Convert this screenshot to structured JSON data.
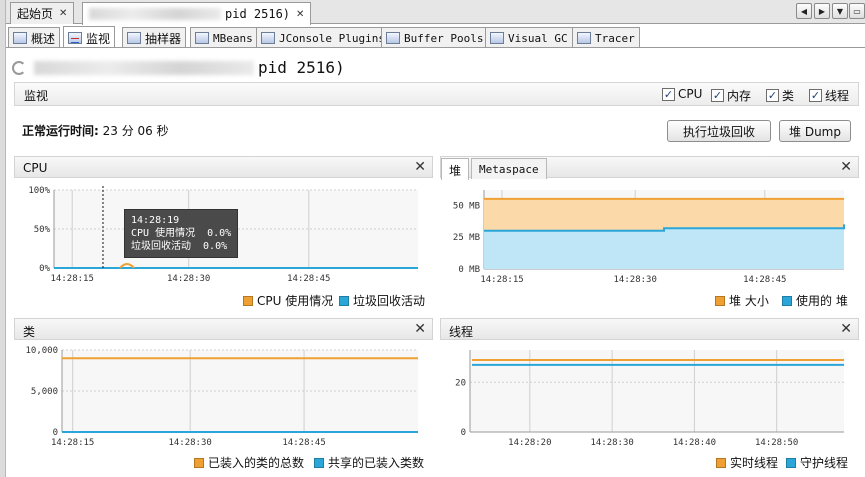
{
  "document_tabs": [
    {
      "label": "起始页",
      "active": false
    },
    {
      "label_suffix": "pid 2516)",
      "active": true
    }
  ],
  "nav": {
    "left": "◀",
    "right": "▶",
    "menu": "▼",
    "restore": "▭"
  },
  "sub_tabs": [
    {
      "label": "概述",
      "icon": "info-icon"
    },
    {
      "label": "监视",
      "icon": "chart-icon",
      "active": true
    },
    {
      "label": "抽样器",
      "icon": "sampler-icon"
    },
    {
      "label": "MBeans",
      "icon": "beans-icon"
    },
    {
      "label": "JConsole Plugins",
      "icon": "plugin-icon"
    },
    {
      "label": "Buffer Pools",
      "icon": "buffer-icon"
    },
    {
      "label": "Visual GC",
      "icon": "gc-icon"
    },
    {
      "label": "Tracer",
      "icon": "tracer-icon"
    }
  ],
  "app_title_suffix": "pid 2516)",
  "monitor": {
    "title": "监视",
    "checkboxes": [
      {
        "label": "CPU",
        "checked": true
      },
      {
        "label": "内存",
        "checked": true
      },
      {
        "label": "类",
        "checked": true
      },
      {
        "label": "线程",
        "checked": true
      }
    ]
  },
  "uptime": {
    "label": "正常运行时间:",
    "value": "23 分 06 秒"
  },
  "buttons": {
    "gc": "执行垃圾回收",
    "heap_dump": "堆 Dump"
  },
  "colors": {
    "orange": "#f0a032",
    "blue": "#2aa7d8",
    "orange_fill": "#fbd9a8",
    "blue_fill": "#bfe6f6"
  },
  "panels": {
    "cpu": {
      "title": "CPU",
      "y_ticks": [
        "100%",
        "50%",
        "0%"
      ],
      "x_ticks": [
        "14:28:15",
        "14:28:30",
        "14:28:45"
      ],
      "legend": [
        "CPU 使用情况",
        "垃圾回收活动"
      ],
      "tooltip": {
        "time": "14:28:19",
        "cpu": "CPU 使用情况  0.0%",
        "gc": "垃圾回收活动  0.0%"
      }
    },
    "heap": {
      "tabs": [
        "堆",
        "Metaspace"
      ],
      "y_ticks": [
        "50 MB",
        "25 MB",
        "0 MB"
      ],
      "x_ticks": [
        "14:28:15",
        "14:28:30",
        "14:28:45"
      ],
      "legend": [
        "堆 大小",
        "使用的 堆"
      ]
    },
    "classes": {
      "title": "类",
      "y_ticks": [
        "10,000",
        "5,000",
        "0"
      ],
      "x_ticks": [
        "14:28:15",
        "14:28:30",
        "14:28:45"
      ],
      "legend": [
        "已装入的类的总数",
        "共享的已装入类数"
      ]
    },
    "threads": {
      "title": "线程",
      "y_ticks": [
        "20",
        "0"
      ],
      "x_ticks": [
        "14:28:20",
        "14:28:30",
        "14:28:40",
        "14:28:50"
      ],
      "legend": [
        "实时线程",
        "守护线程"
      ]
    }
  },
  "chart_data": [
    {
      "type": "line",
      "title": "CPU",
      "ylim": [
        0,
        100
      ],
      "x": [
        "14:28:15",
        "14:28:30",
        "14:28:45"
      ],
      "series": [
        {
          "name": "CPU 使用情况",
          "values": [
            0,
            0,
            0
          ]
        },
        {
          "name": "垃圾回收活动",
          "values": [
            0,
            0,
            0
          ]
        }
      ]
    },
    {
      "type": "area",
      "title": "堆",
      "x": [
        "14:28:15",
        "14:28:30",
        "14:28:45"
      ],
      "series": [
        {
          "name": "堆 大小",
          "values": [
            55,
            55,
            55
          ]
        },
        {
          "name": "使用的 堆",
          "values": [
            30,
            32,
            35
          ]
        }
      ]
    },
    {
      "type": "line",
      "title": "类",
      "ylim": [
        0,
        10000
      ],
      "x": [
        "14:28:15",
        "14:28:30",
        "14:28:45"
      ],
      "series": [
        {
          "name": "已装入的类的总数",
          "values": [
            9000,
            9000,
            9000
          ]
        },
        {
          "name": "共享的已装入类数",
          "values": [
            0,
            0,
            0
          ]
        }
      ]
    },
    {
      "type": "line",
      "title": "线程",
      "x": [
        "14:28:20",
        "14:28:30",
        "14:28:40",
        "14:28:50"
      ],
      "series": [
        {
          "name": "实时线程",
          "values": [
            29,
            29,
            29,
            29
          ]
        },
        {
          "name": "守护线程",
          "values": [
            27,
            27,
            27,
            27
          ]
        }
      ]
    }
  ]
}
